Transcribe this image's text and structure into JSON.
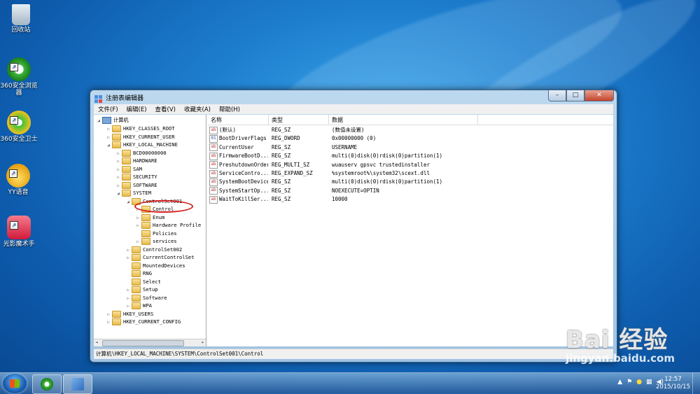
{
  "desktop": {
    "icons": [
      {
        "label": "回收站"
      },
      {
        "label": "360安全浏览器"
      },
      {
        "label": "360安全卫士"
      },
      {
        "label": "YY语音"
      },
      {
        "label": "光影魔术手"
      }
    ]
  },
  "window": {
    "title": "注册表编辑器",
    "buttons": {
      "minimize": "–",
      "maximize": "□",
      "close": "✕"
    },
    "menu": [
      "文件(F)",
      "编辑(E)",
      "查看(V)",
      "收藏夹(A)",
      "帮助(H)"
    ]
  },
  "tree": {
    "root": "计算机",
    "nodes": [
      "HKEY_CLASSES_ROOT",
      "HKEY_CURRENT_USER",
      "HKEY_LOCAL_MACHINE",
      "BCD00000000",
      "HARDWARE",
      "SAM",
      "SECURITY",
      "SOFTWARE",
      "SYSTEM",
      "ControlSet001",
      "Control",
      "Enum",
      "Hardware Profile",
      "Policies",
      "services",
      "ControlSet002",
      "CurrentControlSet",
      "MountedDevices",
      "RNG",
      "Select",
      "Setup",
      "Software",
      "WPA",
      "HKEY_USERS",
      "HKEY_CURRENT_CONFIG"
    ],
    "selected": "Control"
  },
  "list": {
    "headers": {
      "name": "名称",
      "type": "类型",
      "data": "数据"
    },
    "rows": [
      {
        "name": "(默认)",
        "type": "REG_SZ",
        "data": "(数值未设置)",
        "icon": "string-value-icon"
      },
      {
        "name": "BootDriverFlags",
        "type": "REG_DWORD",
        "data": "0x00000000 (0)",
        "icon": "binary-value-icon"
      },
      {
        "name": "CurrentUser",
        "type": "REG_SZ",
        "data": "USERNAME",
        "icon": "string-value-icon"
      },
      {
        "name": "FirmwareBootD...",
        "type": "REG_SZ",
        "data": "multi(0)disk(0)rdisk(0)partition(1)",
        "icon": "string-value-icon"
      },
      {
        "name": "PreshutdownOrder",
        "type": "REG_MULTI_SZ",
        "data": "wuauserv gpsvc trustedinstaller",
        "icon": "string-value-icon"
      },
      {
        "name": "ServiceContro...",
        "type": "REG_EXPAND_SZ",
        "data": "%systemroot%\\system32\\scext.dll",
        "icon": "string-value-icon"
      },
      {
        "name": "SystemBootDevice",
        "type": "REG_SZ",
        "data": "multi(0)disk(0)rdisk(0)partition(1)",
        "icon": "string-value-icon"
      },
      {
        "name": "SystemStartOp...",
        "type": "REG_SZ",
        "data": " NOEXECUTE=OPTIN",
        "icon": "string-value-icon"
      },
      {
        "name": "WaitToKillSer...",
        "type": "REG_SZ",
        "data": "10000",
        "icon": "string-value-icon"
      }
    ]
  },
  "status": "计算机\\HKEY_LOCAL_MACHINE\\SYSTEM\\ControlSet001\\Control",
  "taskbar": {
    "clock_time": "12:57",
    "clock_date": "2015/10/15"
  },
  "watermark": {
    "brand": "Bai 经验",
    "url": "jingyan.baidu.com"
  }
}
